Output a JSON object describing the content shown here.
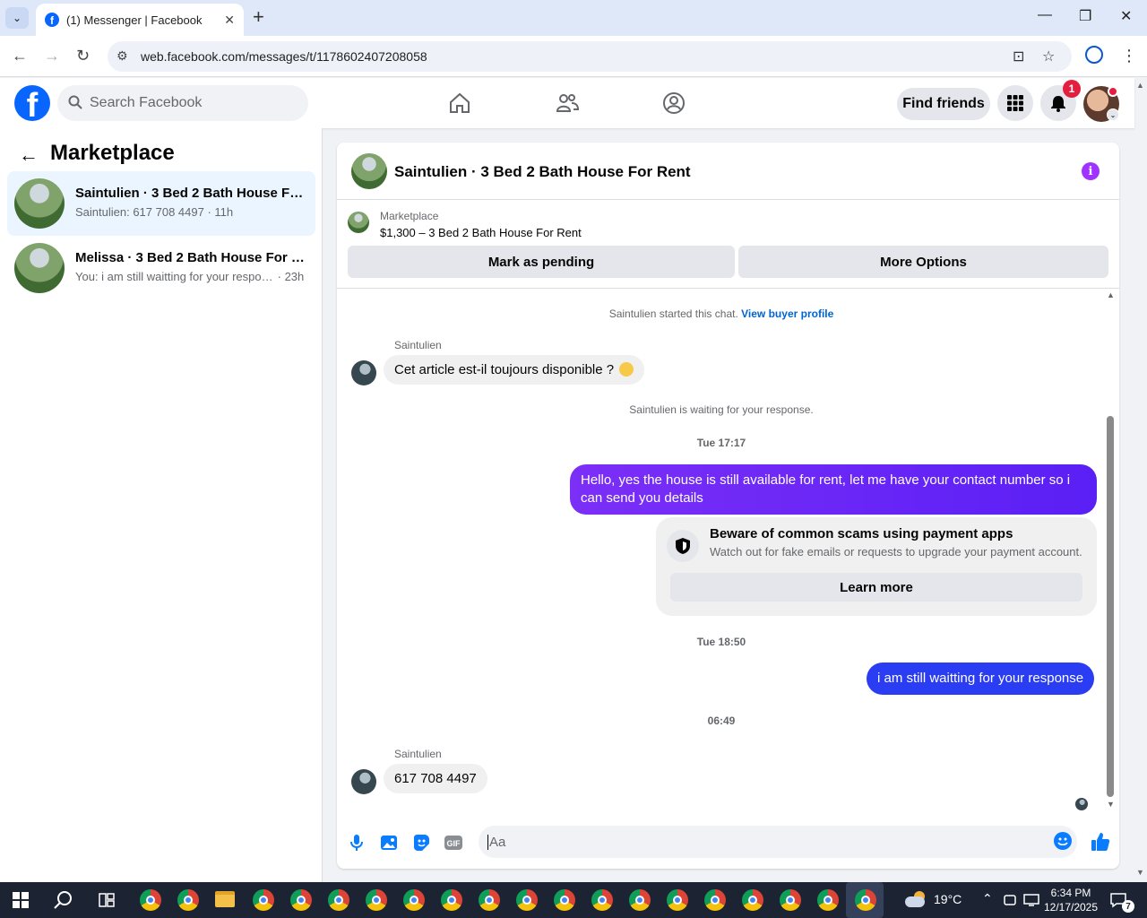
{
  "browser": {
    "tab_title": "(1) Messenger | Facebook",
    "url": "web.facebook.com/messages/t/1178602407208058"
  },
  "header": {
    "search_placeholder": "Search Facebook",
    "find_friends": "Find friends",
    "notifications_count": "1"
  },
  "sidebar": {
    "title": "Marketplace",
    "conversations": [
      {
        "name": "Saintulien · 3 Bed 2 Bath House For Rent",
        "snippet": "Saintulien: 617 708 4497",
        "time": "11h",
        "active": true
      },
      {
        "name": "Melissa · 3 Bed 2 Bath House For Rent",
        "snippet": "You: i am still waitting for your response",
        "time": "23h",
        "active": false
      }
    ]
  },
  "chat": {
    "title": "Saintulien · 3 Bed 2 Bath House For Rent",
    "listing": {
      "label": "Marketplace",
      "price_title": "$1,300 – 3 Bed 2 Bath House For Rent",
      "mark_pending": "Mark as pending",
      "more_options": "More Options"
    },
    "started_text": "Saintulien started this chat.",
    "view_buyer_profile": "View buyer profile",
    "messages": {
      "m1_sender": "Saintulien",
      "m1_text": "Cet article est-il toujours disponible ?",
      "waiting": "Saintulien is waiting for your response.",
      "stamp1": "Tue 17:17",
      "m2_text": "Hello, yes the house is still available for rent, let me have your contact number so i can send you  details",
      "warning_title": "Beware of common scams using payment apps",
      "warning_desc": "Watch out for fake emails or requests to upgrade your payment account.",
      "learn_more": "Learn more",
      "stamp2": "Tue 18:50",
      "m3_text": "i am still waitting for your response",
      "stamp3": "06:49",
      "m4_sender": "Saintulien",
      "m4_text": "617   708 4497"
    },
    "composer_placeholder": "Aa"
  },
  "taskbar": {
    "weather": "19°C",
    "time": "6:34 PM",
    "date": "12/17/2025",
    "notification_count": "7"
  },
  "colors": {
    "fb_blue": "#0866ff",
    "outgoing_purple": "#6a28f6",
    "outgoing_blue": "#2b3df3",
    "info_purple": "#a033ff"
  }
}
